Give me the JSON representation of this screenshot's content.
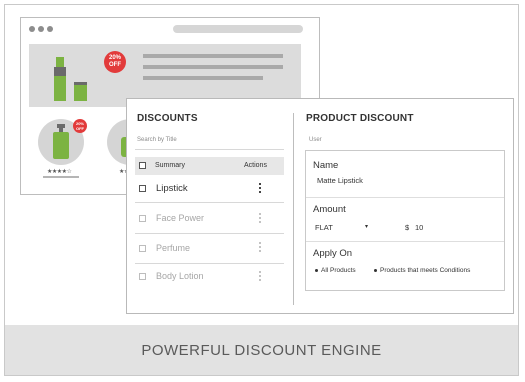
{
  "footer": {
    "title": "POWERFUL DISCOUNT ENGINE"
  },
  "banner": {
    "badge_line1": "20%",
    "badge_line2": "OFF"
  },
  "product_cards": [
    {
      "badge_line1": "20%",
      "badge_line2": "OFF",
      "stars": "★★★★☆"
    },
    {
      "stars": "★★★"
    }
  ],
  "discounts": {
    "title": "DISCOUNTS",
    "search_placeholder": "Search by Title",
    "columns": {
      "summary": "Summary",
      "actions": "Actions"
    },
    "rows": [
      {
        "label": "Lipstick",
        "active": true
      },
      {
        "label": "Face Power",
        "active": false
      },
      {
        "label": "Perfume",
        "active": false
      },
      {
        "label": "Body Lotion",
        "active": false
      }
    ]
  },
  "product_discount": {
    "title": "PRODUCT DISCOUNT",
    "user_label": "User",
    "name_label": "Name",
    "name_value": "Matte Lipstick",
    "amount_label": "Amount",
    "amount_type": "FLAT",
    "amount_caret": "▾",
    "currency": "$",
    "amount_value": "10",
    "apply_label": "Apply On",
    "apply_options": [
      "All Products",
      "Products that meets Conditions"
    ]
  },
  "colors": {
    "accent_red": "#e23b3b",
    "product_green": "#7cb342"
  }
}
